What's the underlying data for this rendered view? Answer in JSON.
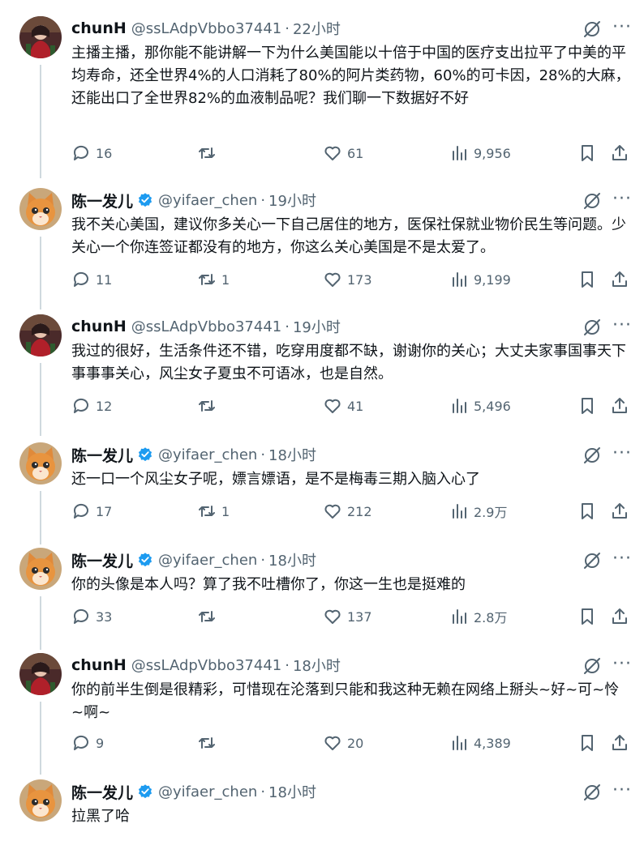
{
  "tweets": [
    {
      "name": "chunH",
      "handle": "@ssLAdpVbbo37441",
      "time": "22小时",
      "verified": false,
      "avatar": "woman-portrait-avatar",
      "text": "主播主播，那你能不能讲解一下为什么美国能以十倍于中国的医疗支出拉平了中美的平均寿命，还全世界4%的人口消耗了80%的阿片类药物，60%的可卡因，28%的大麻，还能出口了全世界82%的血液制品呢？我们聊一下数据好不好",
      "replies": "16",
      "retweets": "",
      "likes": "61",
      "views": "9,956"
    },
    {
      "name": "陈一发儿",
      "handle": "@yifaer_chen",
      "time": "19小时",
      "verified": true,
      "avatar": "orange-cat-avatar",
      "text": "我不关心美国，建议你多关心一下自己居住的地方，医保社保就业物价民生等问题。少关心一个你连签证都没有的地方，你这么关心美国是不是太爱了。",
      "replies": "11",
      "retweets": "1",
      "likes": "173",
      "views": "9,199"
    },
    {
      "name": "chunH",
      "handle": "@ssLAdpVbbo37441",
      "time": "19小时",
      "verified": false,
      "avatar": "woman-portrait-avatar",
      "text": "我过的很好，生活条件还不错，吃穿用度都不缺，谢谢你的关心；大丈夫家事国事天下事事事关心，风尘女子夏虫不可语冰，也是自然。",
      "replies": "12",
      "retweets": "",
      "likes": "41",
      "views": "5,496"
    },
    {
      "name": "陈一发儿",
      "handle": "@yifaer_chen",
      "time": "18小时",
      "verified": true,
      "avatar": "orange-cat-avatar",
      "text": "还一口一个风尘女子呢，嫖言嫖语，是不是梅毒三期入脑入心了",
      "replies": "17",
      "retweets": "1",
      "likes": "212",
      "views": "2.9万"
    },
    {
      "name": "陈一发儿",
      "handle": "@yifaer_chen",
      "time": "18小时",
      "verified": true,
      "avatar": "orange-cat-avatar",
      "text": "你的头像是本人吗？算了我不吐槽你了，你这一生也是挺难的",
      "replies": "33",
      "retweets": "",
      "likes": "137",
      "views": "2.8万"
    },
    {
      "name": "chunH",
      "handle": "@ssLAdpVbbo37441",
      "time": "18小时",
      "verified": false,
      "avatar": "woman-portrait-avatar",
      "text": "你的前半生倒是很精彩，可惜现在沦落到只能和我这种无赖在网络上掰头~好~可~怜~啊~",
      "replies": "9",
      "retweets": "",
      "likes": "20",
      "views": "4,389"
    },
    {
      "name": "陈一发儿",
      "handle": "@yifaer_chen",
      "time": "18小时",
      "verified": true,
      "avatar": "orange-cat-avatar",
      "text": "拉黑了哈",
      "replies": "",
      "retweets": "",
      "likes": "",
      "views": ""
    }
  ],
  "separator": "·",
  "more_glyph": "···",
  "colors": {
    "verified_blue": "#1d9bf0",
    "secondary_text": "#536471",
    "thread_line": "#cfd9de"
  }
}
